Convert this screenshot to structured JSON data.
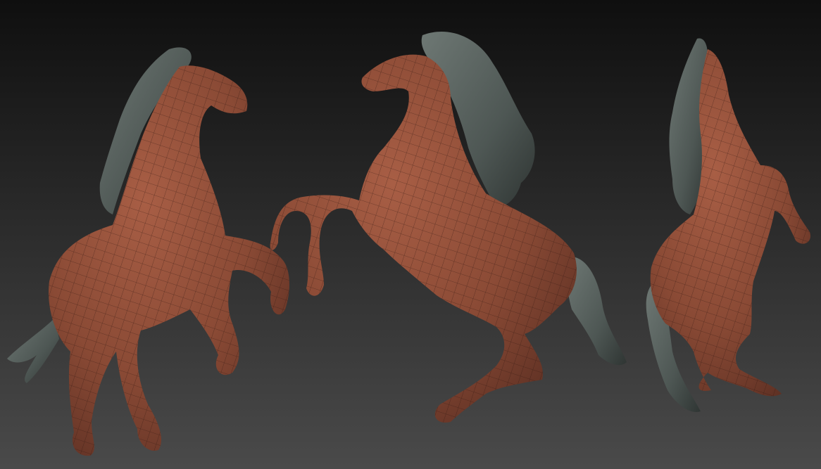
{
  "scene": {
    "description_visible_text": "",
    "colors": {
      "background_top": "#0f0f0f",
      "background_bottom": "#4a4a4a",
      "body": "#8a4a35",
      "body_shadow": "#5a2e22",
      "body_light": "#a85e45",
      "wire": "#2a140e",
      "mane": "#4e5754",
      "mane_dark": "#2f3533",
      "mane_light": "#6e7874"
    }
  },
  "models": [
    {
      "name": "horse-left-view"
    },
    {
      "name": "horse-center-view"
    },
    {
      "name": "horse-right-view"
    }
  ]
}
